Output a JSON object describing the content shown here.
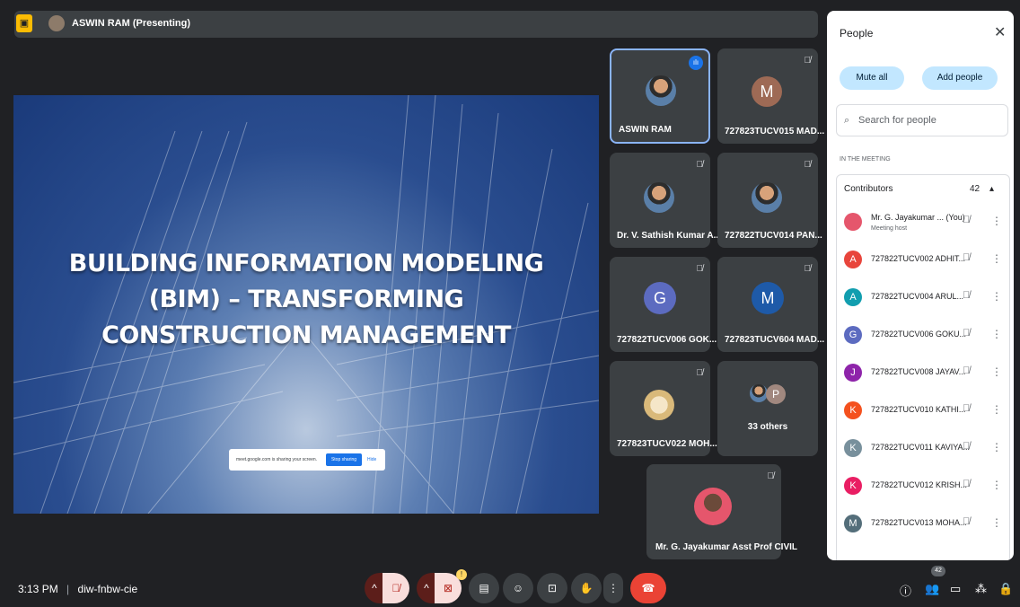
{
  "presenting": {
    "icon": "present-screen-icon",
    "label": "ASWIN RAM (Presenting)"
  },
  "slide": {
    "title_lines": [
      "BUILDING INFORMATION MODELING",
      "(BIM) – TRANSFORMING",
      "CONSTRUCTION MANAGEMENT"
    ],
    "share_popup": {
      "text": "meet.google.com is sharing your screen.",
      "stop": "Stop sharing",
      "hide": "Hide"
    }
  },
  "tiles": [
    {
      "name": "ASWIN RAM"
    },
    {
      "name": "727823TUCV015 MAD...",
      "initial": "M"
    },
    {
      "name": "Dr. V. Sathish Kumar A..."
    },
    {
      "name": "727822TUCV014 PAN..."
    },
    {
      "name": "727822TUCV006 GOK...",
      "initial": "G"
    },
    {
      "name": "727823TUCV604 MAD...",
      "initial": "M"
    },
    {
      "name": "727823TUCV022 MOH..."
    },
    {
      "name": "33 others",
      "initial": "P"
    },
    {
      "name": "Mr. G. Jayakumar Asst Prof CIVIL"
    }
  ],
  "people": {
    "title": "People",
    "mute_all": "Mute all",
    "add_people": "Add people",
    "search_placeholder": "Search for people",
    "section": "IN THE MEETING",
    "contributors_label": "Contributors",
    "contributors_count": "42",
    "host": {
      "name": "Mr. G. Jayakumar ...",
      "you": "(You)",
      "role": "Meeting host"
    },
    "list": [
      {
        "initial": "A",
        "name": "727822TUCV002 ADHIT...",
        "color": "#e8453c"
      },
      {
        "initial": "A",
        "name": "727822TUCV004 ARUL...",
        "color": "#129eaf"
      },
      {
        "initial": "G",
        "name": "727822TUCV006 GOKU...",
        "color": "#5c6bc0"
      },
      {
        "initial": "J",
        "name": "727822TUCV008 JAYAV...",
        "color": "#8e24aa"
      },
      {
        "initial": "K",
        "name": "727822TUCV010 KATHI...",
        "color": "#f4511e"
      },
      {
        "initial": "K",
        "name": "727822TUCV011 KAVIYA...",
        "color": "#78909c"
      },
      {
        "initial": "K",
        "name": "727822TUCV012 KRISH...",
        "color": "#e91e63"
      },
      {
        "initial": "M",
        "name": "727822TUCV013 MOHA...",
        "color": "#546e7a"
      }
    ]
  },
  "bottom": {
    "time": "3:13 PM",
    "code": "diw-fnbw-cie",
    "people_badge": "42",
    "notify_badge": "!"
  }
}
